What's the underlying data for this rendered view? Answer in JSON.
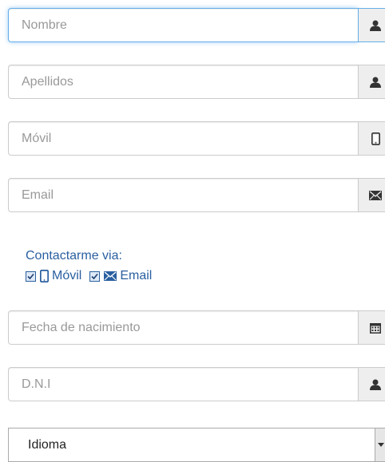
{
  "form": {
    "nombre": {
      "placeholder": "Nombre",
      "icon": "user-icon"
    },
    "apellidos": {
      "placeholder": "Apellidos",
      "icon": "user-icon"
    },
    "movil": {
      "placeholder": "Móvil",
      "icon": "mobile-phone-icon"
    },
    "email": {
      "placeholder": "Email",
      "icon": "envelope-icon"
    },
    "contact": {
      "title": "Contactarme via:",
      "options": [
        {
          "label": "Móvil",
          "checked": true,
          "icon": "mobile-phone-icon"
        },
        {
          "label": "Email",
          "checked": true,
          "icon": "envelope-icon"
        }
      ]
    },
    "fecha": {
      "placeholder": "Fecha de nacimiento",
      "icon": "calendar-icon"
    },
    "dni": {
      "placeholder": "D.N.I",
      "icon": "user-icon"
    },
    "idioma": {
      "selected": "Idioma"
    }
  },
  "colors": {
    "focus_border": "#66afe9",
    "link_blue": "#2a5fa0",
    "addon_bg": "#eeeeee",
    "border": "#cccccc"
  }
}
